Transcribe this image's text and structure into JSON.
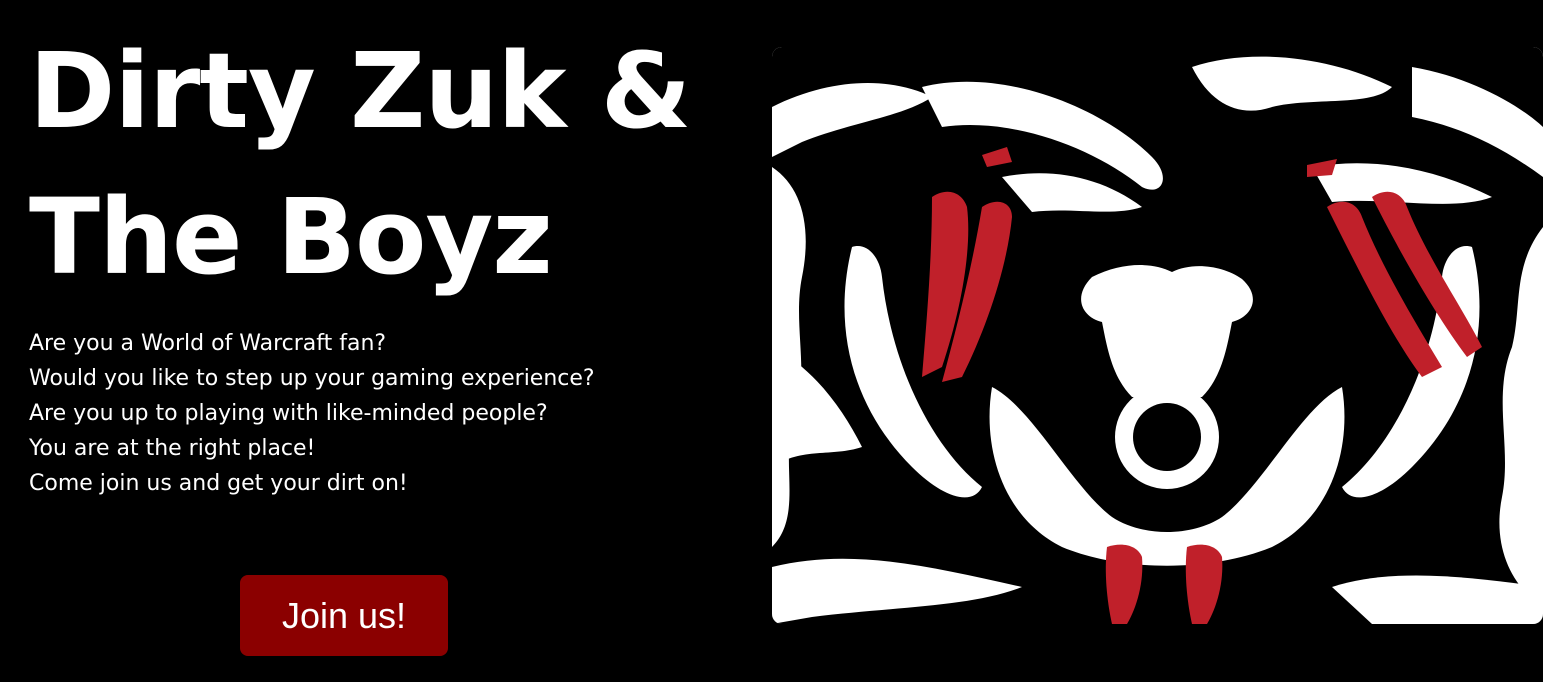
{
  "hero": {
    "title_line1": "Dirty Zuk &",
    "title_line2": "The Boyz",
    "lines": [
      "Are you a World of Warcraft fan?",
      "Would you like to step up your gaming experience?",
      "Are you up to playing with like-minded people?",
      "You are at the right place!",
      "Come join us and get your dirt on!"
    ],
    "join_label": "Join us!"
  },
  "image": {
    "icon": "orc-face-illustration"
  },
  "colors": {
    "background": "#000000",
    "text": "#ffffff",
    "button": "#8b0000",
    "war_paint": "#c0202a"
  }
}
